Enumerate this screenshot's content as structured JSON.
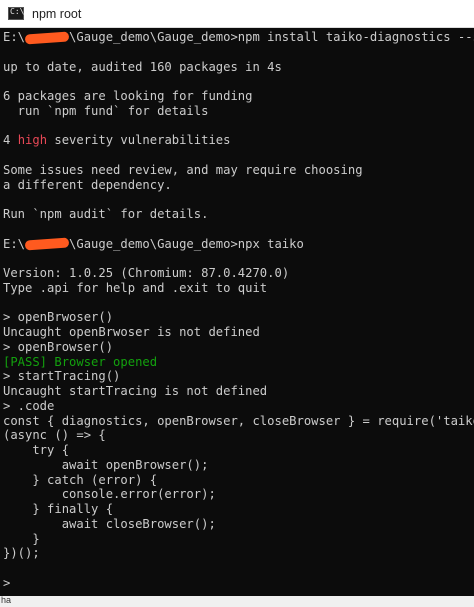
{
  "window": {
    "title": "npm root",
    "icon": "command-prompt-icon",
    "icon_glyph": "C:\\"
  },
  "terminal": {
    "background": "#0c0c0c",
    "foreground": "#cccccc",
    "pass_color": "#13a10e",
    "high_color": "#e74856",
    "redaction_color": "#ff5a1f",
    "lines": [
      {
        "segs": [
          {
            "t": "E:\\"
          },
          {
            "redact": true
          },
          {
            "t": "\\Gauge_demo\\Gauge_demo>npm install taiko-diagnostics --save"
          }
        ]
      },
      {
        "segs": []
      },
      {
        "segs": [
          {
            "t": "up to date, audited 160 packages in 4s"
          }
        ]
      },
      {
        "segs": []
      },
      {
        "segs": [
          {
            "t": "6 packages are looking for funding"
          }
        ]
      },
      {
        "segs": [
          {
            "t": "  run `npm fund` for details"
          }
        ]
      },
      {
        "segs": []
      },
      {
        "segs": [
          {
            "t": "4 "
          },
          {
            "t": "high",
            "c": "red"
          },
          {
            "t": " severity vulnerabilities"
          }
        ]
      },
      {
        "segs": []
      },
      {
        "segs": [
          {
            "t": "Some issues need review, and may require choosing"
          }
        ]
      },
      {
        "segs": [
          {
            "t": "a different dependency."
          }
        ]
      },
      {
        "segs": []
      },
      {
        "segs": [
          {
            "t": "Run `npm audit` for details."
          }
        ]
      },
      {
        "segs": []
      },
      {
        "segs": [
          {
            "t": "E:\\"
          },
          {
            "redact": true
          },
          {
            "t": "\\Gauge_demo\\Gauge_demo>npx taiko"
          }
        ]
      },
      {
        "segs": []
      },
      {
        "segs": [
          {
            "t": "Version: 1.0.25 (Chromium: 87.0.4270.0)"
          }
        ]
      },
      {
        "segs": [
          {
            "t": "Type .api for help and .exit to quit"
          }
        ]
      },
      {
        "segs": []
      },
      {
        "segs": [
          {
            "t": "> openBrwoser()"
          }
        ]
      },
      {
        "segs": [
          {
            "t": "Uncaught openBrwoser is not defined"
          }
        ]
      },
      {
        "segs": [
          {
            "t": "> openBrowser()"
          }
        ]
      },
      {
        "segs": [
          {
            "t": "[PASS] Browser opened",
            "c": "green"
          }
        ]
      },
      {
        "segs": [
          {
            "t": "> startTracing()"
          }
        ]
      },
      {
        "segs": [
          {
            "t": "Uncaught startTracing is not defined"
          }
        ]
      },
      {
        "segs": [
          {
            "t": "> .code"
          }
        ]
      },
      {
        "segs": [
          {
            "t": "const { diagnostics, openBrowser, closeBrowser } = require('taiko');"
          }
        ]
      },
      {
        "segs": [
          {
            "t": "(async () => {"
          }
        ]
      },
      {
        "segs": [
          {
            "t": "    try {"
          }
        ]
      },
      {
        "segs": [
          {
            "t": "        await openBrowser();"
          }
        ]
      },
      {
        "segs": [
          {
            "t": "    } catch (error) {"
          }
        ]
      },
      {
        "segs": [
          {
            "t": "        console.error(error);"
          }
        ]
      },
      {
        "segs": [
          {
            "t": "    } finally {"
          }
        ]
      },
      {
        "segs": [
          {
            "t": "        await closeBrowser();"
          }
        ]
      },
      {
        "segs": [
          {
            "t": "    }"
          }
        ]
      },
      {
        "segs": [
          {
            "t": "})();"
          }
        ]
      },
      {
        "segs": []
      },
      {
        "segs": [
          {
            "t": ">"
          }
        ]
      }
    ]
  },
  "bottom_strip": {
    "text": "ha"
  }
}
